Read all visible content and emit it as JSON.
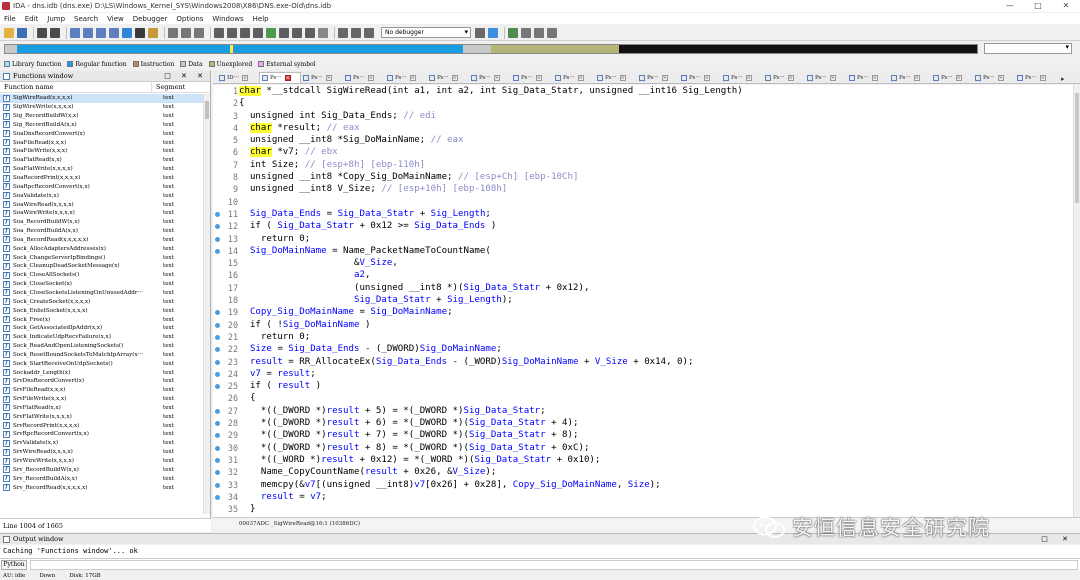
{
  "window": {
    "title": "IDA - dns.idb (dns.exe) D:\\LS\\Windows_Kernel_SYS\\Windows2008\\X86\\DNS.exe-Old\\dns.idb",
    "controls": [
      "—",
      "□",
      "✕"
    ]
  },
  "menu": [
    "File",
    "Edit",
    "Jump",
    "Search",
    "View",
    "Debugger",
    "Options",
    "Windows",
    "Help"
  ],
  "toolbar": {
    "debugger_select": "No debugger"
  },
  "legend": [
    {
      "label": "Library function",
      "color": "#8fe8ff"
    },
    {
      "label": "Regular function",
      "color": "#1a9de0"
    },
    {
      "label": "Instruction",
      "color": "#b08870"
    },
    {
      "label": "Data",
      "color": "#c9c9c9"
    },
    {
      "label": "Unexplored",
      "color": "#b5b57a"
    },
    {
      "label": "External symbol",
      "color": "#ff9dff"
    }
  ],
  "functions_window": {
    "title": "Functions window",
    "controls": "□ ✕ ✕",
    "col_name": "Function name",
    "col_segment": "Segment",
    "status": "Line 1004 of 1665",
    "items": [
      {
        "name": "SigWireRead(x,x,x,x)",
        "seg": "text"
      },
      {
        "name": "SigWireWrite(x,x,x,x)",
        "seg": "text"
      },
      {
        "name": "Sig_RecordBuildW(x,x)",
        "seg": "text"
      },
      {
        "name": "Sig_RecordBuildA(x,x)",
        "seg": "text"
      },
      {
        "name": "SoaDnsRecordConvert(x)",
        "seg": "text"
      },
      {
        "name": "SoaFileRead(x,x,x)",
        "seg": "text"
      },
      {
        "name": "SoaFileWrite(x,x,x)",
        "seg": "text"
      },
      {
        "name": "SoaFlatRead(x,x)",
        "seg": "text"
      },
      {
        "name": "SoaFlatWrite(x,x,x,x)",
        "seg": "text"
      },
      {
        "name": "SoaRecordPrint(x,x,x,x)",
        "seg": "text"
      },
      {
        "name": "SoaRpcRecordConvert(x,x)",
        "seg": "text"
      },
      {
        "name": "SoaValidate(x,x)",
        "seg": "text"
      },
      {
        "name": "SoaWireRead(x,x,x,x)",
        "seg": "text"
      },
      {
        "name": "SoaWireWrite(x,x,x,x)",
        "seg": "text"
      },
      {
        "name": "Soa_RecordBuildW(x,x)",
        "seg": "text"
      },
      {
        "name": "Soa_RecordBuildA(x,x)",
        "seg": "text"
      },
      {
        "name": "Soa_RecordRead(x,x,x,x,x)",
        "seg": "text"
      },
      {
        "name": "Sock_AllocAdaptersAddresses(x)",
        "seg": "text"
      },
      {
        "name": "Sock_ChangeServerIpBindings()",
        "seg": "text"
      },
      {
        "name": "Sock_CleanupDeadSocketMessage(x)",
        "seg": "text"
      },
      {
        "name": "Sock_CloseAllSockets()",
        "seg": "text"
      },
      {
        "name": "Sock_CloseSocket(x)",
        "seg": "text"
      },
      {
        "name": "Sock_CloseSocketsListeningOnUnusedAddr···",
        "seg": "text"
      },
      {
        "name": "Sock_CreateSocket(x,x,x,x)",
        "seg": "text"
      },
      {
        "name": "Sock_EnlistSocket(x,x,x,x)",
        "seg": "text"
      },
      {
        "name": "Sock_Free(x)",
        "seg": "text"
      },
      {
        "name": "Sock_GetAssociatedIpAddr(x,x)",
        "seg": "text"
      },
      {
        "name": "Sock_IndicateUdpRecvFailure(x,x)",
        "seg": "text"
      },
      {
        "name": "Sock_ReadAndOpenListeningSockets()",
        "seg": "text"
      },
      {
        "name": "Sock_ResetBoundSocketsToMatchIpArray(x···",
        "seg": "text"
      },
      {
        "name": "Sock_StartReceiveOnUdpSockets()",
        "seg": "text"
      },
      {
        "name": "Sockaddr_Length(x)",
        "seg": "text"
      },
      {
        "name": "SrvDnsRecordConvert(x)",
        "seg": "text"
      },
      {
        "name": "SrvFileRead(x,x,x)",
        "seg": "text"
      },
      {
        "name": "SrvFileWrite(x,x,x)",
        "seg": "text"
      },
      {
        "name": "SrvFlatRead(x,x)",
        "seg": "text"
      },
      {
        "name": "SrvFlatWrite(x,x,x,x)",
        "seg": "text"
      },
      {
        "name": "SrvRecordPrint(x,x,x,x)",
        "seg": "text"
      },
      {
        "name": "SrvRpcRecordConvert(x,x)",
        "seg": "text"
      },
      {
        "name": "SrvValidate(x,x)",
        "seg": "text"
      },
      {
        "name": "SrvWireRead(x,x,x,x)",
        "seg": "text"
      },
      {
        "name": "SrvWireWrite(x,x,x,x)",
        "seg": "text"
      },
      {
        "name": "Srv_RecordBuildW(x,x)",
        "seg": "text"
      },
      {
        "name": "Srv_RecordBuildA(x,x)",
        "seg": "text"
      },
      {
        "name": "Srv_RecordRead(x,x,x,x,x)",
        "seg": "text"
      }
    ]
  },
  "tabs": [
    {
      "label": "ID···",
      "active": false
    },
    {
      "label": "Ps···",
      "active": true
    },
    {
      "label": "Ps···",
      "active": false
    },
    {
      "label": "Ps···",
      "active": false
    },
    {
      "label": "Ps···",
      "active": false
    },
    {
      "label": "Ps···",
      "active": false
    },
    {
      "label": "Ps···",
      "active": false
    },
    {
      "label": "Ps···",
      "active": false
    },
    {
      "label": "Ps···",
      "active": false
    },
    {
      "label": "Ps···",
      "active": false
    },
    {
      "label": "Ps···",
      "active": false
    },
    {
      "label": "Ps···",
      "active": false
    },
    {
      "label": "Ps···",
      "active": false
    },
    {
      "label": "Ps···",
      "active": false
    },
    {
      "label": "Ps···",
      "active": false
    },
    {
      "label": "Ps···",
      "active": false
    },
    {
      "label": "Ps···",
      "active": false
    },
    {
      "label": "Ps···",
      "active": false
    },
    {
      "label": "Ps···",
      "active": false
    },
    {
      "label": "Ps···",
      "active": false
    }
  ],
  "code": {
    "status": "00037ADC _SigWireRead@16:1 (10386DC)",
    "lines": [
      {
        "n": "1",
        "bp": false,
        "html": "<span class=\"hl\">char</span> *__stdcall SigWireRead(int a1, int a2, int Sig_Data_Statr, unsigned __int16 Sig_Length)"
      },
      {
        "n": "2",
        "bp": false,
        "html": "{"
      },
      {
        "n": "3",
        "bp": false,
        "html": "  unsigned int Sig_Data_Ends; <span class=\"cm\">// edi</span>"
      },
      {
        "n": "4",
        "bp": false,
        "html": "  <span class=\"hl\">char</span> *result; <span class=\"cm\">// eax</span>"
      },
      {
        "n": "5",
        "bp": false,
        "html": "  unsigned __int8 *Sig_DoMainName; <span class=\"cm\">// eax</span>"
      },
      {
        "n": "6",
        "bp": false,
        "html": "  <span class=\"hl\">char</span> *v7; <span class=\"cm\">// ebx</span>"
      },
      {
        "n": "7",
        "bp": false,
        "html": "  int Size; <span class=\"cm\">// [esp+8h] [ebp-110h]</span>"
      },
      {
        "n": "8",
        "bp": false,
        "html": "  unsigned __int8 *Copy_Sig_DoMainName; <span class=\"cm\">// [esp+Ch] [ebp-10Ch]</span>"
      },
      {
        "n": "9",
        "bp": false,
        "html": "  unsigned __int8 V_Size; <span class=\"cm\">// [esp+10h] [ebp-108h]</span>"
      },
      {
        "n": "10",
        "bp": false,
        "html": ""
      },
      {
        "n": "11",
        "bp": true,
        "html": "  <span class=\"idt\">Sig_Data_Ends</span> = <span class=\"idt\">Sig_Data_Statr</span> + <span class=\"idt\">Sig_Length</span>;"
      },
      {
        "n": "12",
        "bp": true,
        "html": "  if ( <span class=\"idt\">Sig_Data_Statr</span> + 0x12 &gt;= <span class=\"idt\">Sig_Data_Ends</span> )"
      },
      {
        "n": "13",
        "bp": true,
        "html": "    return 0;"
      },
      {
        "n": "14",
        "bp": true,
        "html": "  <span class=\"idt\">Sig_DoMainName</span> = Name_PacketNameToCountName("
      },
      {
        "n": "15",
        "bp": false,
        "html": "                     &amp;<span class=\"idt\">V_Size</span>,"
      },
      {
        "n": "16",
        "bp": false,
        "html": "                     <span class=\"idt\">a2</span>,"
      },
      {
        "n": "17",
        "bp": false,
        "html": "                     (unsigned __int8 *)(<span class=\"idt\">Sig_Data_Statr</span> + 0x12),"
      },
      {
        "n": "18",
        "bp": false,
        "html": "                     <span class=\"idt\">Sig_Data_Statr</span> + <span class=\"idt\">Sig_Length</span>);"
      },
      {
        "n": "19",
        "bp": true,
        "html": "  <span class=\"idt\">Copy_Sig_DoMainName</span> = <span class=\"idt\">Sig_DoMainName</span>;"
      },
      {
        "n": "20",
        "bp": true,
        "html": "  if ( !<span class=\"idt\">Sig_DoMainName</span> )"
      },
      {
        "n": "21",
        "bp": true,
        "html": "    return 0;"
      },
      {
        "n": "22",
        "bp": true,
        "html": "  <span class=\"idt\">Size</span> = <span class=\"idt\">Sig_Data_Ends</span> - (_DWORD)<span class=\"idt\">Sig_DoMainName</span>;"
      },
      {
        "n": "23",
        "bp": true,
        "html": "  <span class=\"idt\">result</span> = RR_AllocateEx(<span class=\"idt\">Sig_Data_Ends</span> - (_WORD)<span class=\"idt\">Sig_DoMainName</span> + <span class=\"idt\">V_Size</span> + 0x14, 0);"
      },
      {
        "n": "24",
        "bp": true,
        "html": "  <span class=\"idt\">v7</span> = <span class=\"idt\">result</span>;"
      },
      {
        "n": "25",
        "bp": true,
        "html": "  if ( <span class=\"idt\">result</span> )"
      },
      {
        "n": "26",
        "bp": false,
        "html": "  {"
      },
      {
        "n": "27",
        "bp": true,
        "html": "    *((_DWORD *)<span class=\"idt\">result</span> + 5) = *(_DWORD *)<span class=\"idt\">Sig_Data_Statr</span>;"
      },
      {
        "n": "28",
        "bp": true,
        "html": "    *((_DWORD *)<span class=\"idt\">result</span> + 6) = *(_DWORD *)(<span class=\"idt\">Sig_Data_Statr</span> + 4);"
      },
      {
        "n": "29",
        "bp": true,
        "html": "    *((_DWORD *)<span class=\"idt\">result</span> + 7) = *(_DWORD *)(<span class=\"idt\">Sig_Data_Statr</span> + 8);"
      },
      {
        "n": "30",
        "bp": true,
        "html": "    *((_DWORD *)<span class=\"idt\">result</span> + 8) = *(_DWORD *)(<span class=\"idt\">Sig_Data_Statr</span> + 0xC);"
      },
      {
        "n": "31",
        "bp": true,
        "html": "    *((_WORD *)<span class=\"idt\">result</span> + 0x12) = *(_WORD *)(<span class=\"idt\">Sig_Data_Statr</span> + 0x10);"
      },
      {
        "n": "32",
        "bp": true,
        "html": "    Name_CopyCountName(<span class=\"idt\">result</span> + 0x26, &amp;<span class=\"idt\">V_Size</span>);"
      },
      {
        "n": "33",
        "bp": true,
        "html": "    memcpy(&amp;<span class=\"idt\">v7</span>[(unsigned __int8)<span class=\"idt\">v7</span>[0x26] + 0x28], <span class=\"idt\">Copy_Sig_DoMainName</span>, <span class=\"idt\">Size</span>);"
      },
      {
        "n": "34",
        "bp": true,
        "html": "    <span class=\"idt\">result</span> = <span class=\"idt\">v7</span>;"
      },
      {
        "n": "35",
        "bp": false,
        "html": "  }"
      }
    ]
  },
  "output": {
    "title": "Output window",
    "controls": "□ ✕",
    "text": "Caching 'Functions window'... ok",
    "lang_button": "Python"
  },
  "statusbar": {
    "au": "AU:  idle",
    "dir": "Down",
    "disk": "Disk: 17GB"
  },
  "watermark": {
    "text": "安恒信息安全研究院"
  }
}
